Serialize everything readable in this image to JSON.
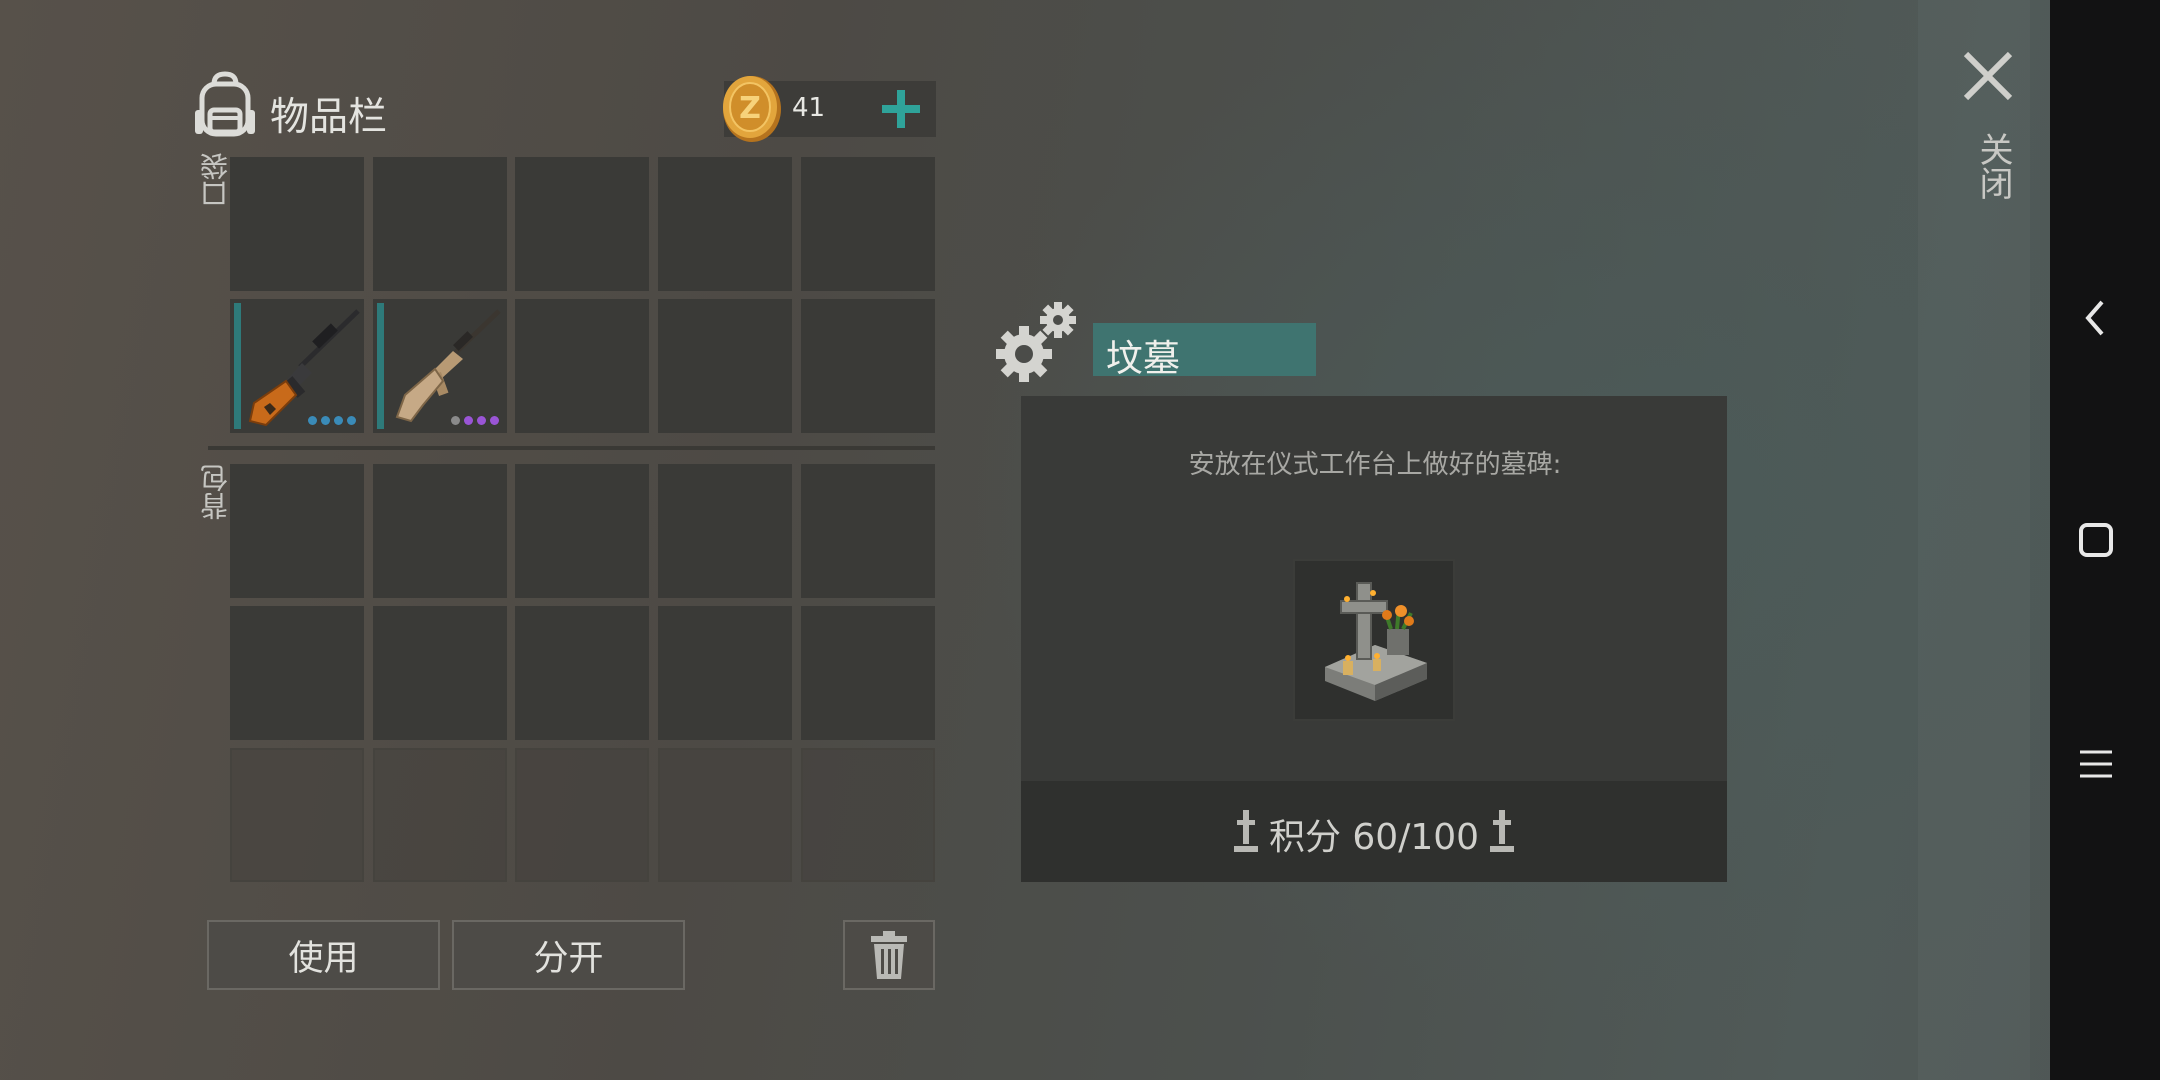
{
  "header": {
    "title": "物品栏",
    "icon": "backpack-icon",
    "coins": "41",
    "coin_icon": "gold-coin-icon",
    "add_icon": "plus-icon"
  },
  "sections": {
    "pocket_label": "口袋",
    "backpack_label": "背包"
  },
  "inventory": {
    "pocket_row1": [
      "",
      "",
      "",
      "",
      ""
    ],
    "pocket_row2": [
      {
        "item": "sniper-rifle",
        "rarity_dots": [
          "#3a8bb8",
          "#3a8bb8",
          "#3a8bb8",
          "#3a8bb8"
        ]
      },
      {
        "item": "assault-rifle",
        "rarity_dots": [
          "#8a8a8a",
          "#9a55d6",
          "#9a55d6",
          "#9a55d6"
        ]
      },
      "",
      "",
      ""
    ]
  },
  "buttons": {
    "use": "使用",
    "split": "分开",
    "delete_icon": "trash-icon"
  },
  "craft": {
    "icon": "gears-icon",
    "tab_title": "坟墓",
    "description": "安放在仪式工作台上做好的墓碑:",
    "item_icon": "tombstone-icon",
    "score_label": "积分 60/100",
    "score_icon": "grave-cross-icon"
  },
  "close": {
    "label": "关闭",
    "icon": "close-icon"
  },
  "system_nav": {
    "back_icon": "back-chevron-icon",
    "home_icon": "home-square-icon",
    "menu_icon": "menu-lines-icon"
  },
  "colors": {
    "accent_teal": "#3f7470",
    "plus_green": "#2fa39a",
    "panel": "#393a38"
  }
}
